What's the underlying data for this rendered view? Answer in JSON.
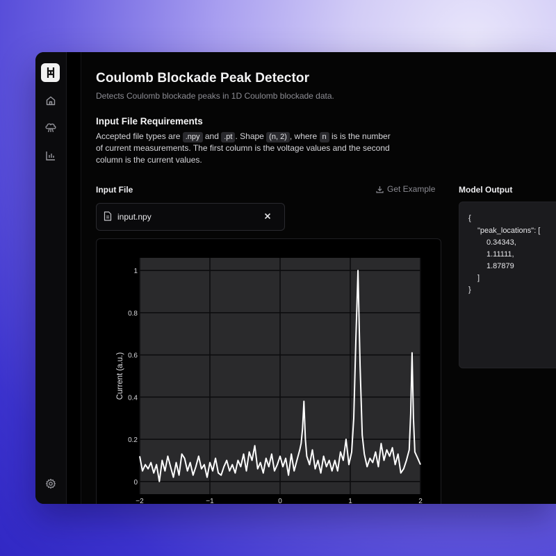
{
  "app": {
    "title": "Coulomb Blockade Peak Detector",
    "subtitle": "Detects Coulomb blockade peaks in 1D Coulomb blockade data."
  },
  "nav": {
    "items": [
      {
        "icon": "home-icon"
      },
      {
        "icon": "model-icon"
      },
      {
        "icon": "bar-chart-icon"
      }
    ],
    "footer_icon": "gear-icon"
  },
  "requirements": {
    "heading": "Input File Requirements",
    "t1": "Accepted file types are ",
    "c1": ".npy",
    "t2": " and ",
    "c2": ".pt",
    "t3": ". Shape ",
    "c3": "(n, 2)",
    "t4": ", where ",
    "c4": "n",
    "t5": " is is the number of current measurements. The first column is the voltage values and the second column is the current values."
  },
  "input": {
    "label": "Input File",
    "get_example": "Get Example",
    "file_name": "input.npy"
  },
  "output": {
    "label": "Model Output",
    "lines": [
      "{",
      "\"peak_locations\": [",
      "0.34343,",
      "1.11111,",
      "1.87879",
      "]",
      "}"
    ]
  },
  "chart_data": {
    "type": "line",
    "title": "",
    "xlabel": "",
    "ylabel": "Current (a.u.)",
    "xlim": [
      -2,
      2
    ],
    "ylim": [
      -0.06,
      1.06
    ],
    "x_ticks": [
      "−2",
      "−1",
      "0",
      "1",
      "2"
    ],
    "y_ticks": [
      "0",
      "0.2",
      "0.4",
      "0.6",
      "0.8",
      "1"
    ],
    "grid": true,
    "series": [
      {
        "x": [
          -2.0,
          -1.96,
          -1.92,
          -1.88,
          -1.84,
          -1.8,
          -1.76,
          -1.72,
          -1.68,
          -1.64,
          -1.6,
          -1.56,
          -1.52,
          -1.48,
          -1.44,
          -1.4,
          -1.36,
          -1.32,
          -1.28,
          -1.24,
          -1.2,
          -1.16,
          -1.12,
          -1.08,
          -1.04,
          -1.0,
          -0.96,
          -0.92,
          -0.88,
          -0.84,
          -0.8,
          -0.76,
          -0.72,
          -0.68,
          -0.64,
          -0.6,
          -0.56,
          -0.52,
          -0.48,
          -0.44,
          -0.4,
          -0.36,
          -0.32,
          -0.28,
          -0.24,
          -0.2,
          -0.16,
          -0.12,
          -0.08,
          -0.04,
          0.0,
          0.04,
          0.08,
          0.12,
          0.16,
          0.2,
          0.24,
          0.28,
          0.3,
          0.32,
          0.34,
          0.36,
          0.38,
          0.42,
          0.46,
          0.5,
          0.54,
          0.58,
          0.62,
          0.66,
          0.7,
          0.74,
          0.78,
          0.82,
          0.86,
          0.9,
          0.94,
          0.98,
          1.02,
          1.05,
          1.08,
          1.11,
          1.14,
          1.17,
          1.2,
          1.24,
          1.28,
          1.32,
          1.36,
          1.4,
          1.44,
          1.48,
          1.52,
          1.56,
          1.6,
          1.64,
          1.68,
          1.72,
          1.76,
          1.8,
          1.84,
          1.86,
          1.88,
          1.9,
          1.92,
          1.96,
          2.0
        ],
        "y": [
          0.12,
          0.05,
          0.08,
          0.06,
          0.09,
          0.04,
          0.08,
          0.0,
          0.1,
          0.05,
          0.12,
          0.07,
          0.02,
          0.09,
          0.03,
          0.13,
          0.11,
          0.05,
          0.09,
          0.03,
          0.07,
          0.12,
          0.06,
          0.08,
          0.02,
          0.09,
          0.05,
          0.11,
          0.04,
          0.03,
          0.07,
          0.1,
          0.05,
          0.08,
          0.04,
          0.1,
          0.07,
          0.13,
          0.05,
          0.14,
          0.1,
          0.17,
          0.06,
          0.09,
          0.04,
          0.11,
          0.07,
          0.13,
          0.05,
          0.08,
          0.12,
          0.07,
          0.11,
          0.03,
          0.13,
          0.05,
          0.1,
          0.15,
          0.18,
          0.25,
          0.38,
          0.2,
          0.12,
          0.08,
          0.15,
          0.06,
          0.1,
          0.04,
          0.12,
          0.07,
          0.1,
          0.05,
          0.1,
          0.05,
          0.14,
          0.1,
          0.2,
          0.08,
          0.14,
          0.3,
          0.68,
          1.0,
          0.55,
          0.22,
          0.13,
          0.07,
          0.11,
          0.09,
          0.14,
          0.07,
          0.18,
          0.1,
          0.15,
          0.12,
          0.16,
          0.08,
          0.13,
          0.04,
          0.06,
          0.1,
          0.15,
          0.32,
          0.61,
          0.3,
          0.14,
          0.11,
          0.08
        ]
      }
    ]
  },
  "colors": {
    "accent_bg": "#3128c4",
    "plot_bg": "#2a2a2c",
    "line": "#ffffff"
  }
}
